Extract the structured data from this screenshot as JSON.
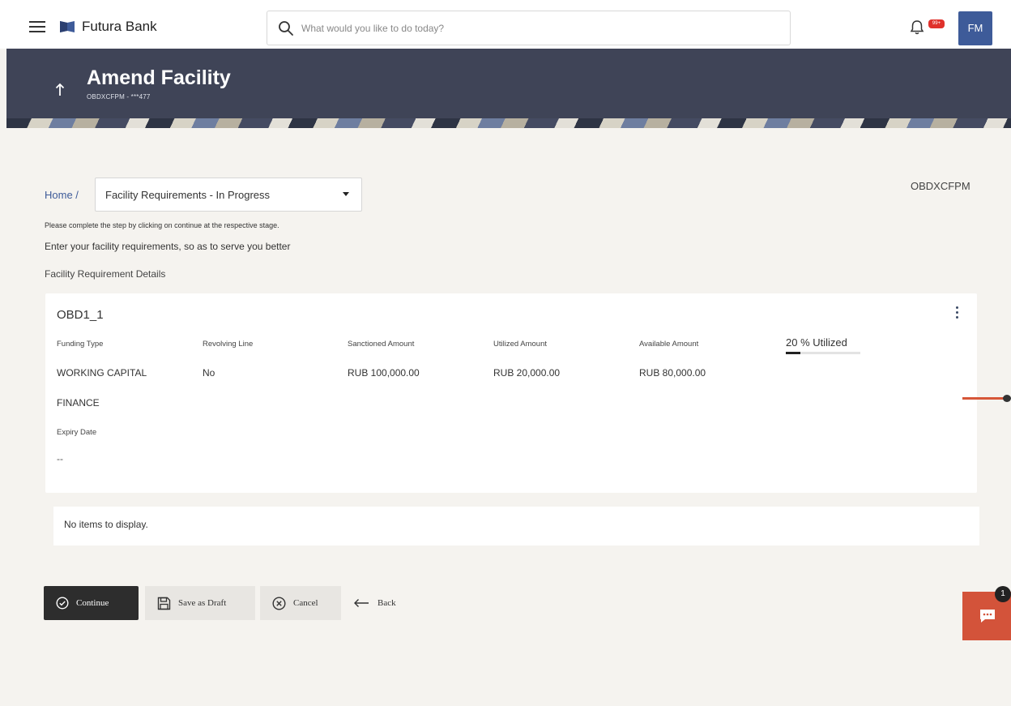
{
  "header": {
    "brand": "Futura Bank",
    "search_placeholder": "What would you like to do today?",
    "notification_badge": "99+",
    "avatar_initials": "FM"
  },
  "banner": {
    "title": "Amend Facility",
    "subtitle": "OBDXCFPM - ***477"
  },
  "breadcrumb": {
    "home": "Home /",
    "stage": "Facility Requirements - In Progress"
  },
  "app_reference": "OBDXCFPM",
  "messages": {
    "instruction": "Please complete the step by clicking on continue at the respective stage.",
    "intro": "Enter your facility requirements, so as to serve you better",
    "section_title": "Facility Requirement Details"
  },
  "facility": {
    "name": "OBD1_1",
    "columns": [
      {
        "label": "Funding Type",
        "value": "WORKING CAPITAL",
        "value_line2": "FINANCE"
      },
      {
        "label": "Revolving Line",
        "value": "No"
      },
      {
        "label": "Sanctioned Amount",
        "value": "RUB 100,000.00"
      },
      {
        "label": "Utilized Amount",
        "value": "RUB 20,000.00"
      },
      {
        "label": "Available Amount",
        "value": "RUB 80,000.00"
      }
    ],
    "utilized_label": "20 % Utilized",
    "utilized_fraction": 0.2,
    "expiry_label": "Expiry Date",
    "expiry_value": "--"
  },
  "empty_list": "No items to display.",
  "actions": {
    "continue": "Continue",
    "save_draft": "Save as Draft",
    "cancel": "Cancel",
    "back": "Back"
  },
  "chat": {
    "badge": "1"
  },
  "colors": {
    "banner": "#3f4457",
    "primary_button": "#2d2d2d",
    "accent": "#3e5b99",
    "chat": "#d3533a"
  }
}
